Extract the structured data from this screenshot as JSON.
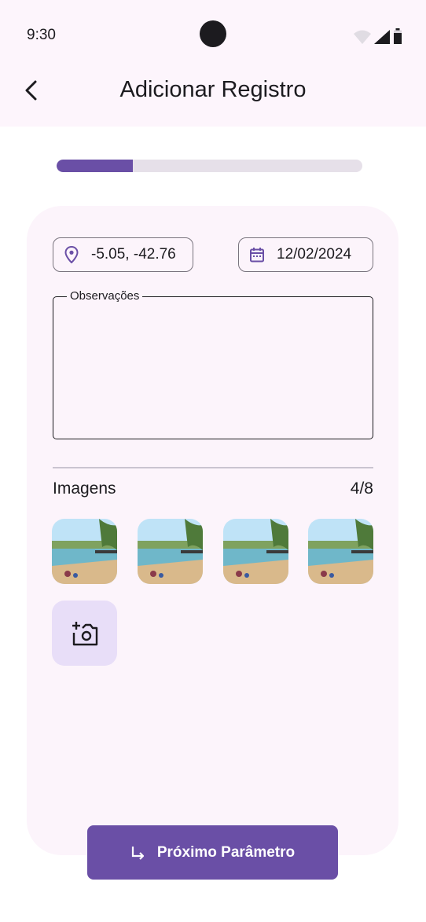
{
  "status_bar": {
    "time": "9:30",
    "icons": [
      "wifi-icon",
      "signal-icon",
      "battery-icon"
    ]
  },
  "app_bar": {
    "title": "Adicionar Registro",
    "back_icon": "arrow-back-icon"
  },
  "progress": {
    "fraction": 0.25,
    "fill_color": "#6a4fa6",
    "track_color": "#e6e0e9"
  },
  "form": {
    "location": {
      "icon": "location-pin-icon",
      "value": "-5.05, -42.76"
    },
    "date": {
      "icon": "calendar-icon",
      "value": "12/02/2024"
    },
    "observations": {
      "label": "Observações",
      "value": ""
    }
  },
  "images": {
    "title": "Imagens",
    "count": "4/8",
    "thumbnails": [
      "thumbnail-1",
      "thumbnail-2",
      "thumbnail-3",
      "thumbnail-4"
    ],
    "add_icon": "add-photo-icon"
  },
  "next_button": {
    "icon": "subdirectory-arrow-right-icon",
    "label": "Próximo Parâmetro"
  },
  "colors": {
    "primary": "#6a4fa6",
    "surface": "#fcf4fb",
    "secondary_container": "#e8def8"
  }
}
